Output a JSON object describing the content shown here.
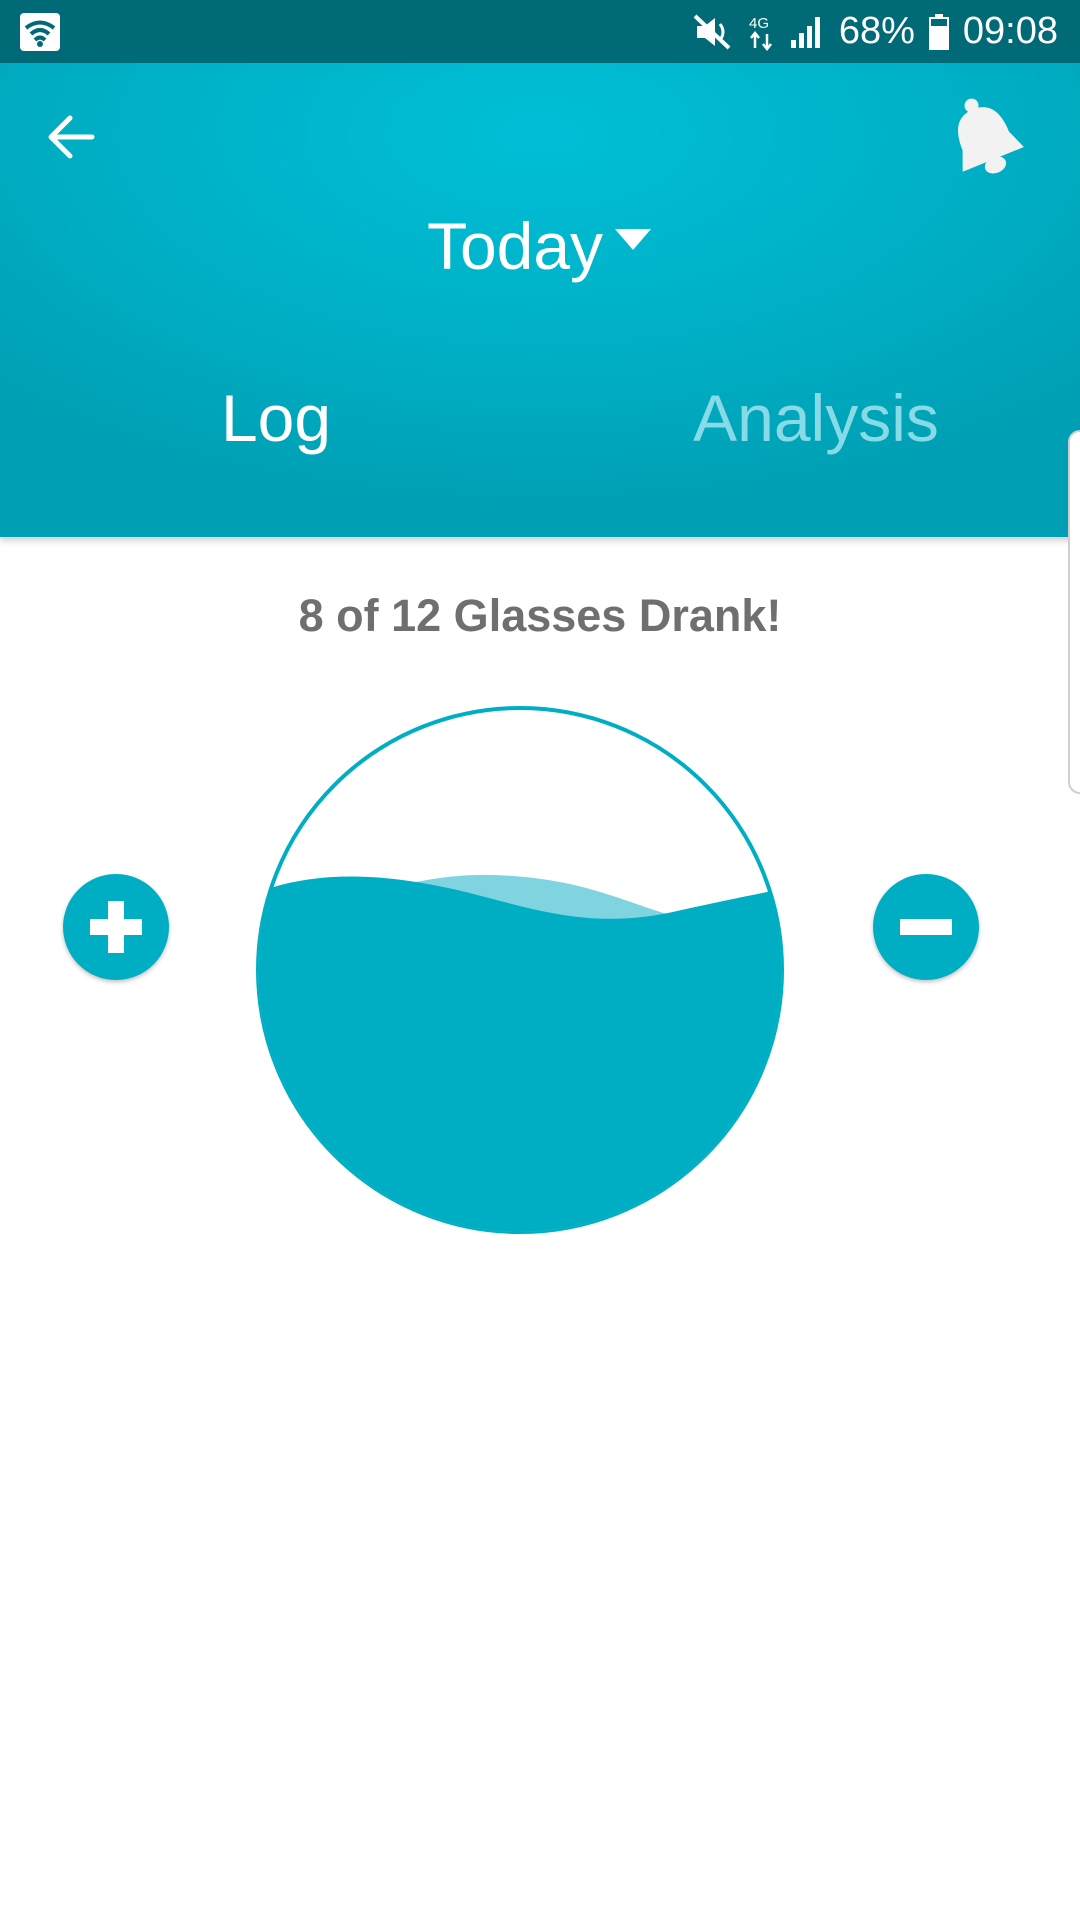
{
  "status_bar": {
    "battery": "68%",
    "time": "09:08",
    "network": "4G",
    "icons": [
      "wifi-icon",
      "mute-icon",
      "network-4g-icon",
      "signal-icon",
      "battery-icon"
    ]
  },
  "header": {
    "date_label": "Today",
    "tabs": [
      {
        "label": "Log",
        "active": true
      },
      {
        "label": "Analysis",
        "active": false
      }
    ],
    "icons": [
      "back-arrow-icon",
      "bell-icon",
      "caret-down-icon"
    ]
  },
  "tracker": {
    "summary": "8 of 12 Glasses Drank!",
    "glasses_drunk": 8,
    "glasses_goal": 12,
    "fill_fraction": 0.667,
    "icons": [
      "plus-icon",
      "minus-icon"
    ]
  },
  "colors": {
    "status_bar": "#006b77",
    "header": "#00b4c9",
    "water": "#00aec4",
    "wave_light": "#7fd4e0",
    "inactive_tab": "#86dbe6",
    "summary_text": "#6f6f6f"
  }
}
